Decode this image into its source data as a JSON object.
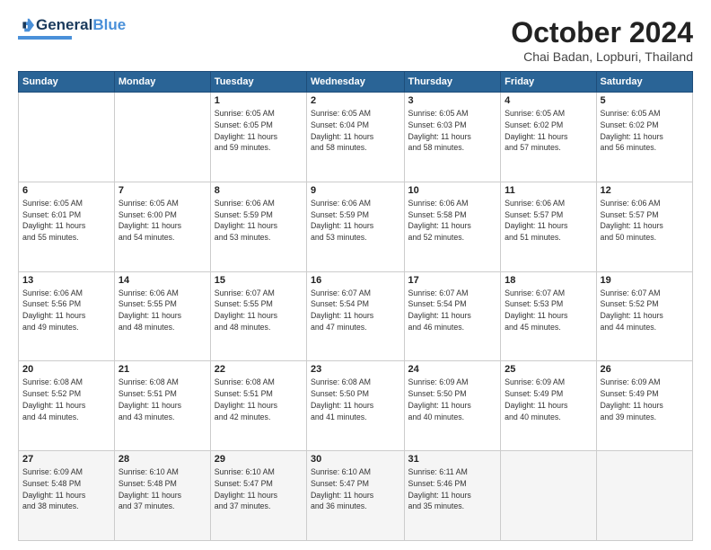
{
  "header": {
    "logo_general": "General",
    "logo_blue": "Blue",
    "month_title": "October 2024",
    "subtitle": "Chai Badan, Lopburi, Thailand"
  },
  "days_of_week": [
    "Sunday",
    "Monday",
    "Tuesday",
    "Wednesday",
    "Thursday",
    "Friday",
    "Saturday"
  ],
  "weeks": [
    [
      {
        "day": "",
        "info": ""
      },
      {
        "day": "",
        "info": ""
      },
      {
        "day": "1",
        "info": "Sunrise: 6:05 AM\nSunset: 6:05 PM\nDaylight: 11 hours\nand 59 minutes."
      },
      {
        "day": "2",
        "info": "Sunrise: 6:05 AM\nSunset: 6:04 PM\nDaylight: 11 hours\nand 58 minutes."
      },
      {
        "day": "3",
        "info": "Sunrise: 6:05 AM\nSunset: 6:03 PM\nDaylight: 11 hours\nand 58 minutes."
      },
      {
        "day": "4",
        "info": "Sunrise: 6:05 AM\nSunset: 6:02 PM\nDaylight: 11 hours\nand 57 minutes."
      },
      {
        "day": "5",
        "info": "Sunrise: 6:05 AM\nSunset: 6:02 PM\nDaylight: 11 hours\nand 56 minutes."
      }
    ],
    [
      {
        "day": "6",
        "info": "Sunrise: 6:05 AM\nSunset: 6:01 PM\nDaylight: 11 hours\nand 55 minutes."
      },
      {
        "day": "7",
        "info": "Sunrise: 6:05 AM\nSunset: 6:00 PM\nDaylight: 11 hours\nand 54 minutes."
      },
      {
        "day": "8",
        "info": "Sunrise: 6:06 AM\nSunset: 5:59 PM\nDaylight: 11 hours\nand 53 minutes."
      },
      {
        "day": "9",
        "info": "Sunrise: 6:06 AM\nSunset: 5:59 PM\nDaylight: 11 hours\nand 53 minutes."
      },
      {
        "day": "10",
        "info": "Sunrise: 6:06 AM\nSunset: 5:58 PM\nDaylight: 11 hours\nand 52 minutes."
      },
      {
        "day": "11",
        "info": "Sunrise: 6:06 AM\nSunset: 5:57 PM\nDaylight: 11 hours\nand 51 minutes."
      },
      {
        "day": "12",
        "info": "Sunrise: 6:06 AM\nSunset: 5:57 PM\nDaylight: 11 hours\nand 50 minutes."
      }
    ],
    [
      {
        "day": "13",
        "info": "Sunrise: 6:06 AM\nSunset: 5:56 PM\nDaylight: 11 hours\nand 49 minutes."
      },
      {
        "day": "14",
        "info": "Sunrise: 6:06 AM\nSunset: 5:55 PM\nDaylight: 11 hours\nand 48 minutes."
      },
      {
        "day": "15",
        "info": "Sunrise: 6:07 AM\nSunset: 5:55 PM\nDaylight: 11 hours\nand 48 minutes."
      },
      {
        "day": "16",
        "info": "Sunrise: 6:07 AM\nSunset: 5:54 PM\nDaylight: 11 hours\nand 47 minutes."
      },
      {
        "day": "17",
        "info": "Sunrise: 6:07 AM\nSunset: 5:54 PM\nDaylight: 11 hours\nand 46 minutes."
      },
      {
        "day": "18",
        "info": "Sunrise: 6:07 AM\nSunset: 5:53 PM\nDaylight: 11 hours\nand 45 minutes."
      },
      {
        "day": "19",
        "info": "Sunrise: 6:07 AM\nSunset: 5:52 PM\nDaylight: 11 hours\nand 44 minutes."
      }
    ],
    [
      {
        "day": "20",
        "info": "Sunrise: 6:08 AM\nSunset: 5:52 PM\nDaylight: 11 hours\nand 44 minutes."
      },
      {
        "day": "21",
        "info": "Sunrise: 6:08 AM\nSunset: 5:51 PM\nDaylight: 11 hours\nand 43 minutes."
      },
      {
        "day": "22",
        "info": "Sunrise: 6:08 AM\nSunset: 5:51 PM\nDaylight: 11 hours\nand 42 minutes."
      },
      {
        "day": "23",
        "info": "Sunrise: 6:08 AM\nSunset: 5:50 PM\nDaylight: 11 hours\nand 41 minutes."
      },
      {
        "day": "24",
        "info": "Sunrise: 6:09 AM\nSunset: 5:50 PM\nDaylight: 11 hours\nand 40 minutes."
      },
      {
        "day": "25",
        "info": "Sunrise: 6:09 AM\nSunset: 5:49 PM\nDaylight: 11 hours\nand 40 minutes."
      },
      {
        "day": "26",
        "info": "Sunrise: 6:09 AM\nSunset: 5:49 PM\nDaylight: 11 hours\nand 39 minutes."
      }
    ],
    [
      {
        "day": "27",
        "info": "Sunrise: 6:09 AM\nSunset: 5:48 PM\nDaylight: 11 hours\nand 38 minutes."
      },
      {
        "day": "28",
        "info": "Sunrise: 6:10 AM\nSunset: 5:48 PM\nDaylight: 11 hours\nand 37 minutes."
      },
      {
        "day": "29",
        "info": "Sunrise: 6:10 AM\nSunset: 5:47 PM\nDaylight: 11 hours\nand 37 minutes."
      },
      {
        "day": "30",
        "info": "Sunrise: 6:10 AM\nSunset: 5:47 PM\nDaylight: 11 hours\nand 36 minutes."
      },
      {
        "day": "31",
        "info": "Sunrise: 6:11 AM\nSunset: 5:46 PM\nDaylight: 11 hours\nand 35 minutes."
      },
      {
        "day": "",
        "info": ""
      },
      {
        "day": "",
        "info": ""
      }
    ]
  ]
}
